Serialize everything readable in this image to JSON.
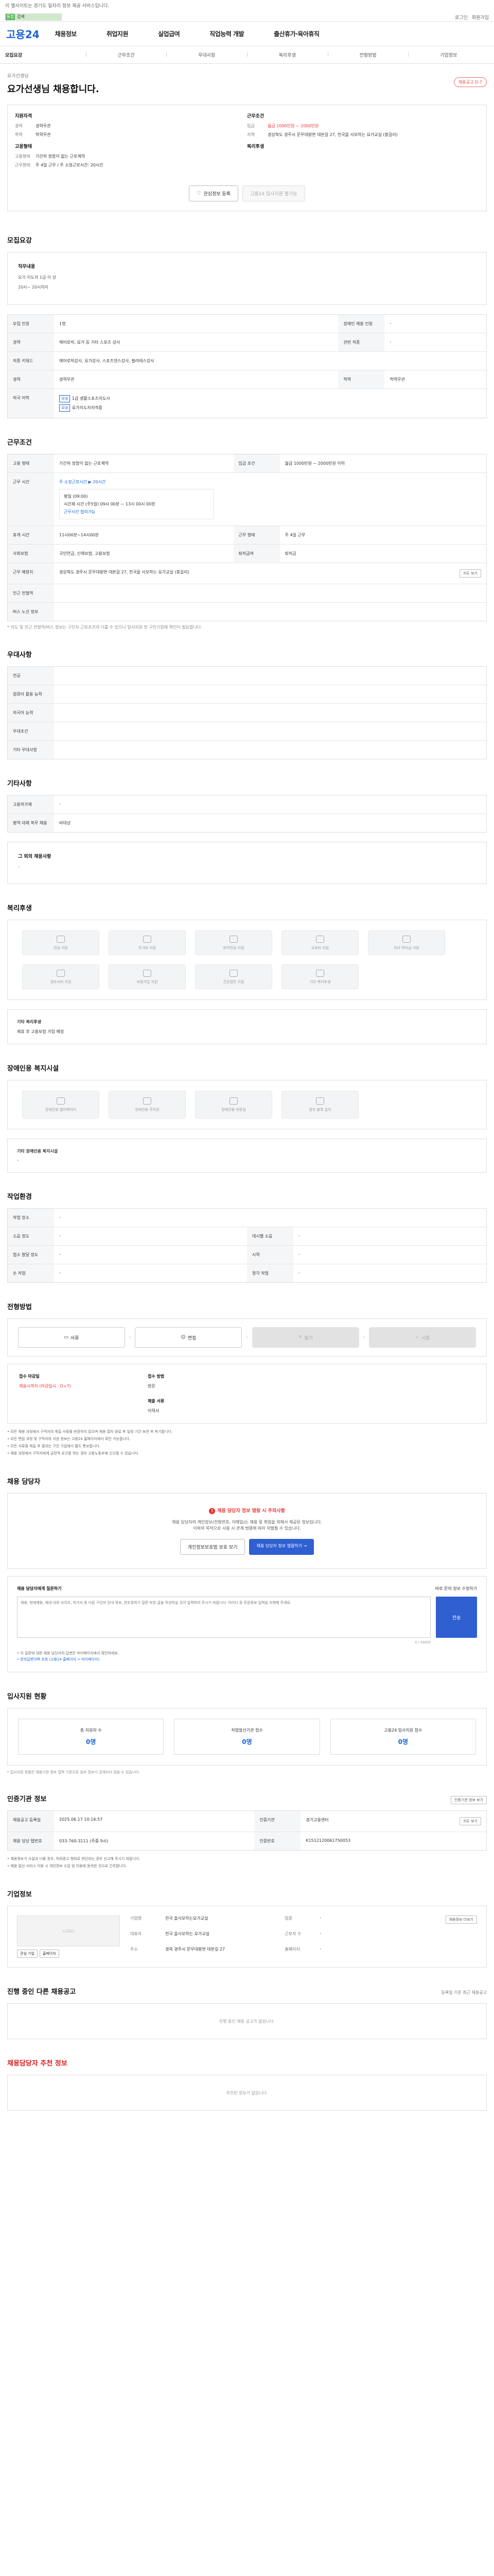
{
  "top": {
    "notice": "이 웹사이트는 경기도 일자리 정보 제공 서비스입니다.",
    "util": [
      "로그인",
      "회원가입"
    ],
    "search_left": "통합",
    "search_right": "검색"
  },
  "gnb": {
    "logo_a": "고용",
    "logo_b": "24",
    "menus": [
      "채용정보",
      "취업지원",
      "실업급여",
      "직업능력 개발",
      "출산휴가·육아휴직"
    ]
  },
  "subtabs": [
    "모집요강",
    "근무조건",
    "우대사항",
    "복리후생",
    "전형방법",
    "기업정보"
  ],
  "headline": {
    "org": "요가선생님",
    "title": "요가선생님 채용합니다.",
    "badge": "채용공고 D-7"
  },
  "summary": {
    "left_title": "지원자격",
    "left": [
      {
        "k": "경력",
        "v": "경력무관"
      },
      {
        "k": "학력",
        "v": "학력무관"
      }
    ],
    "left_title2": "고용형태",
    "left2": [
      {
        "k": "고용형태",
        "v": "기간의 정함이 없는 근로계약"
      },
      {
        "k": "근무형태",
        "v": "주 4일 근무 / 주 소정근로시간: 20시간"
      }
    ],
    "right_title": "근무조건",
    "right": [
      {
        "k": "임금",
        "v": "월급 1000만원 ~ 2000만원"
      },
      {
        "k": "지역",
        "v": "경상북도 경주시 문무대왕면 대본길 27, 천국을 사모하는 요가교실 (봉길리)"
      }
    ],
    "right_title2": "복리후생",
    "btn_interest": "관심정보 등록",
    "btn_apply": "고용24 입사지원 불가능"
  },
  "recruit": {
    "title": "모집요강",
    "field_title": "직무내용",
    "field_line1": "요가 지도자 1급 이 상",
    "field_line2": "20시~ 20시까지",
    "rows": [
      {
        "k1": "모집 인원",
        "v1": "1명",
        "k2": "장애인 채용 인원",
        "v2": "-"
      },
      {
        "k1": "경력",
        "v1": "에어로빅, 요가 등 기타 스포츠 강사",
        "k2": "관련 직종",
        "v2": "-"
      },
      {
        "k1": "직종 키워드",
        "v1": "에어로빅강사, 요가강사, 스포츠댄스강사, 필라테스강사",
        "k2": "",
        "v2": ""
      },
      {
        "k1": "경력",
        "v1": "경력무관",
        "k2": "학력",
        "v2": "학력무관"
      }
    ],
    "lang_label": "외국 어학",
    "lang_tag": "우대",
    "lang_v1": "1급 생활스포츠지도사",
    "lang_v2": "요가지도자자격증"
  },
  "condition": {
    "title": "근무조건",
    "r1": {
      "k1": "고용 형태",
      "v1": "기간의 정함이 없는 근로계약",
      "k2": "임금 조건",
      "v2": "월급 1000만원 ~ 2000만원 이하"
    },
    "flex": "주 소정근로시간 ▶ 20시간",
    "time_title": "근무 시간",
    "time1": "평일 (09:00)",
    "time2": "시간제 시간 (주5일) 09시 00분 ~ 13시 00시 00분",
    "time3": "근무시간 협의가능",
    "r3": {
      "k1": "휴게 시간",
      "v1": "11시00분~14시00분",
      "k2": "근무 형태",
      "v2": "주 4일 근무"
    },
    "r4": {
      "k1": "사회보험",
      "v1": "국민연금, 산재보험, 고용보험",
      "k2": "퇴직급여",
      "v2": "퇴직금"
    },
    "r5": {
      "k1": "근무 예정지",
      "v1": "경상북도 경주시 문무대왕면 대본길 27, 천국을 사모하는 요가교실 (봉길리)",
      "btn": "지도 보기"
    },
    "r6k": "인근 전철역",
    "r7k": "버스 노선 정보",
    "note": "* 지도 및 인근 전철역/버스 정보는 구인자 근로조건과 다를 수 있으니 입사지원 전 구인기업에 확인이 필요합니다."
  },
  "pref": {
    "title": "우대사항",
    "rows": [
      "전공",
      "컴퓨터 활용 능력",
      "외국어 능력",
      "우대조건",
      "기타 우대사항"
    ]
  },
  "etc": {
    "title": "기타사항",
    "rows": [
      {
        "k": "고용허가제",
        "v": "-"
      },
      {
        "k": "병역 대체 복무 채용",
        "v": "비대상"
      }
    ],
    "sub": "그 외의 채용사항",
    "sub_v": "-"
  },
  "welfare": {
    "title": "복리후생",
    "items": [
      "연금 지원",
      "주거비 지원",
      "퇴직연금 지원",
      "교육비 지원",
      "자녀 학자금 지원",
      "경조사비 지원",
      "보험가입 지원",
      "건강검진 지원",
      "기타 복리후생"
    ],
    "info_label": "기타 복리후생",
    "info_v": "제휴 후 고용보험 가입 예정"
  },
  "disabled": {
    "title": "장애인용 복지시설",
    "items": [
      "장애인용 엘리베이터",
      "장애인용 주차장",
      "장애인용 화장실",
      "점자 블록 설치"
    ],
    "info_label": "기타 장애인용 복지시설",
    "info_v": "-"
  },
  "work_env": {
    "title": "작업환경",
    "rows": [
      {
        "k1": "작업 장소",
        "v1": "-",
        "k2": "",
        "v2": ""
      },
      {
        "k1": "소음 정도",
        "v1": "-",
        "k2": "데시벨 소음",
        "v2": "-"
      },
      {
        "k1": "협소 발달 정도",
        "v1": "-",
        "k2": "시력",
        "v2": "-"
      },
      {
        "k1": "손 작업",
        "v1": "-",
        "k2": "청각 작업",
        "v2": "-"
      }
    ]
  },
  "process": {
    "title": "전형방법",
    "steps": [
      "서류",
      "면접",
      "필기",
      "시험"
    ],
    "apply_title": "접수 마감일",
    "apply_date": "채용시까지 (마감일시 : D+7)",
    "method_title": "접수 방법",
    "method": "방문",
    "docs_title": "제출 서류",
    "docs": "이력서",
    "notes": [
      "• 모든 채용 과정에서 구직자의 제출 서류를 반환하지 않으며 채용 절차 완료 후 일정 기간 보관 후 파기합니다.",
      "• 모든 면접 과정 및 구직자의 지원 정보는 고용24 홈페이지에서 확인 가능합니다.",
      "• 모든 서류를 제출 후 결과는 구인 기업에서 별도 통보합니다.",
      "• 채용 과정에서 구직자에게 금전적 요구를 하는 경우 고용노동부에 신고할 수 있습니다."
    ]
  },
  "manager": {
    "title": "채용 담당자",
    "warn": "채용 담당자 정보 열람 시 주의사항",
    "warn_text1": "채용 담당자의 개인정보(전화번호, 이메일)는 채용 및 취업을 위해서 제공된 정보입니다.",
    "warn_text2": "이외의 목적으로 사용 시 관계 법령에 따라 처벌될 수 있습니다.",
    "btn1": "개인정보보호법 보호 보기",
    "btn2": "채용 담당자 정보 열람하기 →"
  },
  "qa": {
    "title": "채용 담당자에게 질문하기",
    "right": "바로 문의 정보 수정하기",
    "placeholder": "채용, 현재채용, 제대 내외 사이즈, 여가서 등 다른 구인자 안내 정보, 연조정하기 질문 또한 글을 작성하실 것이 입력하여 주시기 바랍니다. 아이디 등 민감정보 입력을 자제해 주세요.",
    "send": "전송",
    "count": "0 / 500자",
    "ul1": "• 이 질문에 대한 채용 담당자의 답변은 마이페이지에서 확인하세요.",
    "ul2": "• 문의답변이력 조회 (고용24 홈페이지 > 마이페이지)"
  },
  "stats": {
    "title": "입사지원 현황",
    "items": [
      {
        "k": "총 지원자 수",
        "v": "0명"
      },
      {
        "k": "직업알선기관 접수",
        "v": "0명"
      },
      {
        "k": "고용24 입사지원 접수",
        "v": "0명"
      }
    ],
    "note": "* 입사지원 현황은 채용기관 정보 입력 기준으로 일부 정보가 공개되지 않을 수 있습니다."
  },
  "cert": {
    "title": "인증기관 정보",
    "right": "인증기관 정보 보기",
    "rows": [
      {
        "k1": "채용공고 등록일",
        "v1": "2025.06.17 10:16:57",
        "k2": "인증기관",
        "v2": "경기고용센터",
        "btn": "지도 보기"
      },
      {
        "k1": "채용 담당 탭번호",
        "v1": "033-760-3111 (주중 9시)",
        "k2": "인증번호",
        "v2": "K1512120061750053"
      }
    ],
    "notes": [
      "• 채용정보가 사실과 다를 경우, 허위광고 행위로 판단되는 경우 신고해 주시기 바랍니다.",
      "• 채용 알선 서비스 이용 시 개인정보 수집 및 이용에 동의한 것으로 간주합니다."
    ]
  },
  "company": {
    "title": "기업정보",
    "logo_alt": "LOGO",
    "b1": "관심 기업",
    "b2": "홈페이지",
    "info": [
      {
        "k": "기업명",
        "v": "천국 을사모하는요가교실"
      },
      {
        "k": "업종",
        "v": "-"
      },
      {
        "k": "대표자",
        "v": "천국 을사모하는 요가교실"
      },
      {
        "k": "근로자 수",
        "v": "-"
      },
      {
        "k": "주소",
        "v": "경북 경주시 문무대왕면 대본길 27"
      },
      {
        "k": "홈페이지",
        "v": "-"
      }
    ],
    "right_btn": "채용정보 더보기"
  },
  "ongoing": {
    "title": "진행 중인 다른 채용공고",
    "right": "등록일 기준 최근 채용공고",
    "empty": "진행 중인 채용 공고가 없습니다."
  },
  "recommend": {
    "title": "채용담당자 추천 정보",
    "empty": "추천된 정보가 없습니다."
  }
}
